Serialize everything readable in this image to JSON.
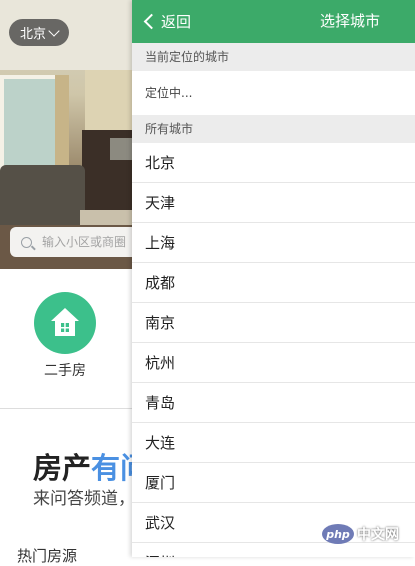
{
  "background": {
    "city_selector": {
      "label": "北京"
    },
    "search": {
      "placeholder": "输入小区或商圈"
    },
    "quick_entry": {
      "label": "二手房"
    },
    "banner": {
      "title_black": "房产",
      "title_accent": "有问",
      "subtitle": "来问答频道，"
    },
    "hot_source_label": "热门房源"
  },
  "panel": {
    "back_label": "返回",
    "title": "选择城市",
    "current_section": "当前定位的城市",
    "locating_text": "定位中...",
    "all_section": "所有城市",
    "cities": [
      "北京",
      "天津",
      "上海",
      "成都",
      "南京",
      "杭州",
      "青岛",
      "大连",
      "厦门",
      "武汉",
      "深圳"
    ]
  },
  "watermark": {
    "php": "php",
    "site": "中文网"
  },
  "colors": {
    "topbar": "#3caa69",
    "house_icon_bg": "#3cc08b",
    "accent_blue": "#4a90e2"
  }
}
